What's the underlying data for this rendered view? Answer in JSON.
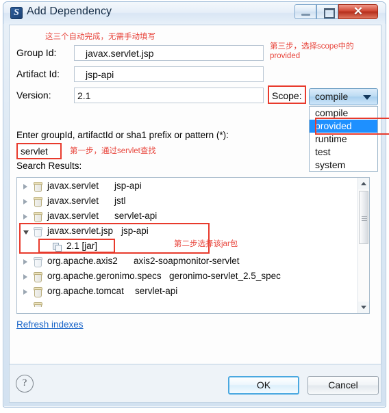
{
  "window": {
    "title": "Add Dependency",
    "icon": "maven-dependency-icon",
    "controls": {
      "minimize": "Minimize",
      "maximize": "Maximize",
      "close": "Close"
    }
  },
  "form": {
    "note_top": "这三个自动完成，无需手动填写",
    "fields": [
      {
        "label": "Group Id:",
        "required_mark": "*",
        "value": "javax.servlet.jsp"
      },
      {
        "label": "Artifact Id:",
        "required_mark": "*",
        "value": "jsp-api"
      },
      {
        "label": "Version:",
        "required_mark": "",
        "value": "2.1"
      }
    ]
  },
  "scope": {
    "label": "Scope:",
    "selected": "compile",
    "note": "第三步，选择scope中的\nprovided",
    "options": [
      {
        "label": "compile",
        "selected": false
      },
      {
        "label": "provided",
        "selected": true
      },
      {
        "label": "runtime",
        "selected": false
      },
      {
        "label": "test",
        "selected": false
      },
      {
        "label": "system",
        "selected": false
      }
    ]
  },
  "search": {
    "query_label": "Enter groupId, artifactId or sha1 prefix or pattern (*):",
    "value": "servlet",
    "placeholder": "",
    "note": "第一步，通过servlet查找",
    "results_label": "Search Results:"
  },
  "results": {
    "note": "第二步选择该jar包",
    "rows": [
      {
        "indent": 0,
        "twisty": "collapsed",
        "icon": "jar-icon",
        "group": "javax.servlet",
        "artifact": "jsp-api",
        "version": ""
      },
      {
        "indent": 0,
        "twisty": "collapsed",
        "icon": "jar-icon",
        "group": "javax.servlet",
        "artifact": "jstl",
        "version": ""
      },
      {
        "indent": 0,
        "twisty": "collapsed",
        "icon": "jar-icon",
        "group": "javax.servlet",
        "artifact": "servlet-api",
        "version": ""
      },
      {
        "indent": 0,
        "twisty": "expanded",
        "icon": "jar-icon-pale",
        "group": "javax.servlet.jsp",
        "artifact": "jsp-api",
        "version": ""
      },
      {
        "indent": 1,
        "twisty": "none",
        "icon": "version-icon",
        "group": "",
        "artifact": "",
        "version": "2.1 [jar]"
      },
      {
        "indent": 0,
        "twisty": "collapsed",
        "icon": "jar-icon-pale",
        "group": "org.apache.axis2",
        "artifact": "axis2-soapmonitor-servlet",
        "version": ""
      },
      {
        "indent": 0,
        "twisty": "collapsed",
        "icon": "jar-icon",
        "group": "org.apache.geronimo.specs",
        "artifact": "geronimo-servlet_2.5_spec",
        "version": ""
      },
      {
        "indent": 0,
        "twisty": "collapsed",
        "icon": "jar-icon",
        "group": "org.apache.tomcat",
        "artifact": "servlet-api",
        "version": ""
      }
    ],
    "scrollbar": {
      "up": "scroll-up",
      "down": "scroll-down"
    }
  },
  "links": {
    "refresh_indexes": "Refresh indexes"
  },
  "footer": {
    "help": "?",
    "ok": "OK",
    "cancel": "Cancel"
  },
  "colors": {
    "annotation_red": "#e8453c",
    "highlight_blue": "#1e90ff",
    "link_blue": "#1b66c9",
    "close_red": "#b52d1b"
  }
}
